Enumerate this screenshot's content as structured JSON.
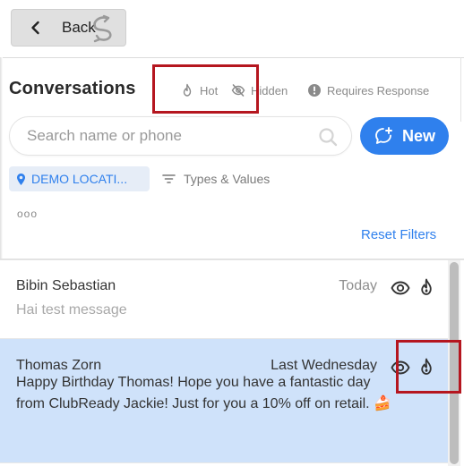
{
  "header": {
    "back_label": "Back"
  },
  "title": "Conversations",
  "filters": {
    "hot": "Hot",
    "hidden": "Hidden",
    "requires_response": "Requires Response"
  },
  "search": {
    "placeholder": "Search name or phone"
  },
  "new_button": "New",
  "location_chip": "DEMO LOCATI...",
  "types_values": "Types & Values",
  "more": "ooo",
  "reset_filters": "Reset Filters",
  "conversations": [
    {
      "name": "Bibin Sebastian",
      "time": "Today",
      "message": "Hai test message"
    },
    {
      "name": "Thomas Zorn",
      "time": "Last Wednesday",
      "message": "Happy Birthday Thomas! Hope you have a fantastic day from ClubReady Jackie! Just for you a 10% off on retail. 🍰"
    }
  ],
  "colors": {
    "accent": "#2f80ed",
    "selected_row": "#cfe2fa",
    "highlight_box": "#b5161f",
    "muted_text": "#8a8a8a"
  },
  "icons": {
    "back": "chevron-left-icon",
    "back_decor": "swirl-icon",
    "hot": "flame-icon",
    "hidden": "eye-off-icon",
    "requires_response": "alert-circle-icon",
    "search": "search-icon",
    "new": "chat-plus-icon",
    "location": "location-pin-icon",
    "types": "filter-lines-icon",
    "view": "eye-icon",
    "fire": "flame-icon"
  }
}
